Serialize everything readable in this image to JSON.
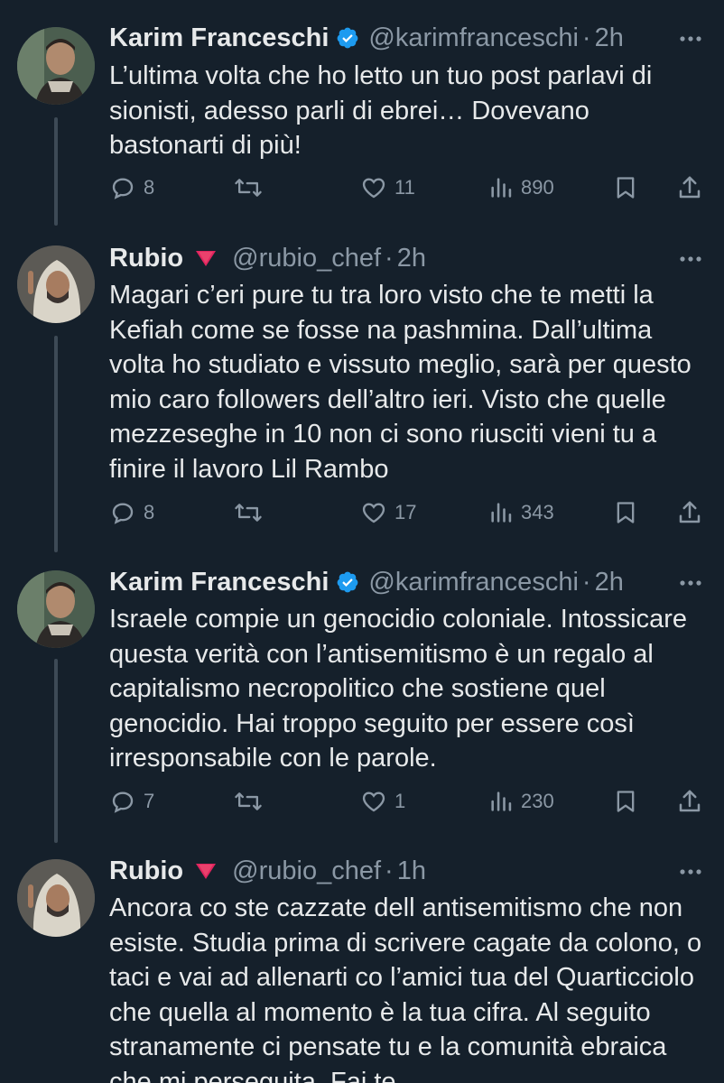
{
  "tweets": [
    {
      "name": "Karim Franceschi",
      "verified": true,
      "handle": "@karimfranceschi",
      "separator": "·",
      "time": "2h",
      "text": "L’ultima volta che ho letto un tuo post parlavi di sionisti, adesso parli di ebrei… Dovevano bastonarti di più!",
      "replies": "8",
      "retweets": "",
      "likes": "11",
      "views": "890"
    },
    {
      "name": "Rubio",
      "verified": false,
      "flag_emoji": "🔻",
      "handle": "@rubio_chef",
      "separator": "·",
      "time": "2h",
      "text": "Magari c’eri pure tu tra loro visto che te metti la Kefiah come se fosse na pashmina. Dall’ultima volta ho studiato e vissuto meglio, sarà per questo mio caro followers dell’altro ieri. Visto che quelle mezzeseghe in 10 non ci sono riusciti vieni tu a finire il lavoro Lil Rambo",
      "replies": "8",
      "retweets": "",
      "likes": "17",
      "views": "343"
    },
    {
      "name": "Karim Franceschi",
      "verified": true,
      "handle": "@karimfranceschi",
      "separator": "·",
      "time": "2h",
      "text": "Israele compie un genocidio coloniale. Intossicare questa verità con l’antisemitismo è un regalo al capitalismo necropolitico che sostiene quel genocidio. Hai troppo seguito per essere così irresponsabile con le parole.",
      "replies": "7",
      "retweets": "",
      "likes": "1",
      "views": "230"
    },
    {
      "name": "Rubio",
      "verified": false,
      "flag_emoji": "🔻",
      "handle": "@rubio_chef",
      "separator": "·",
      "time": "1h",
      "text": "Ancora co ste cazzate dell antisemitismo che non esiste. Studia prima di scrivere cagate da colono, o taci e vai ad allenarti co l’amici tua del Quarticciolo che quella al momento è la tua cifra. Al seguito stranamente ci pensate tu e la comunità ebraica che mi perseguita. Fai te"
    }
  ],
  "icons": {
    "verified": "verified-badge-icon",
    "flag": "red-triangle-icon",
    "more": "more-dots-icon",
    "reply": "reply-icon",
    "retweet": "retweet-icon",
    "like": "heart-icon",
    "views": "views-icon",
    "bookmark": "bookmark-icon",
    "share": "share-icon"
  },
  "colors": {
    "background": "#15202b",
    "text": "#e7e9ea",
    "secondary": "#8b98a5",
    "verified": "#1d9bf0",
    "flag": "#e0245e"
  }
}
